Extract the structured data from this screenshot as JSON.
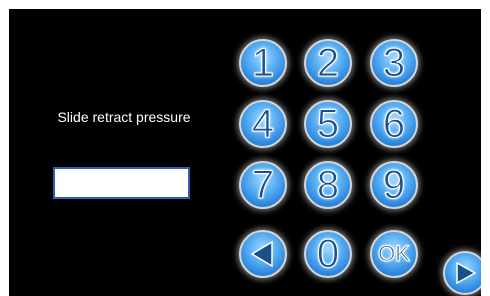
{
  "prompt_label": "Slide retract pressure",
  "entry_value": "",
  "keys": {
    "k1": "1",
    "k2": "2",
    "k3": "3",
    "k4": "4",
    "k5": "5",
    "k6": "6",
    "k7": "7",
    "k8": "8",
    "k9": "9",
    "k0": "0",
    "ok": "OK"
  },
  "icons": {
    "back": "left-arrow-icon",
    "next": "right-arrow-icon"
  },
  "colors": {
    "background": "#000000",
    "key_blue": "#2e88df",
    "key_text": "#1b4f8c",
    "entry_border": "#2f5fae"
  }
}
